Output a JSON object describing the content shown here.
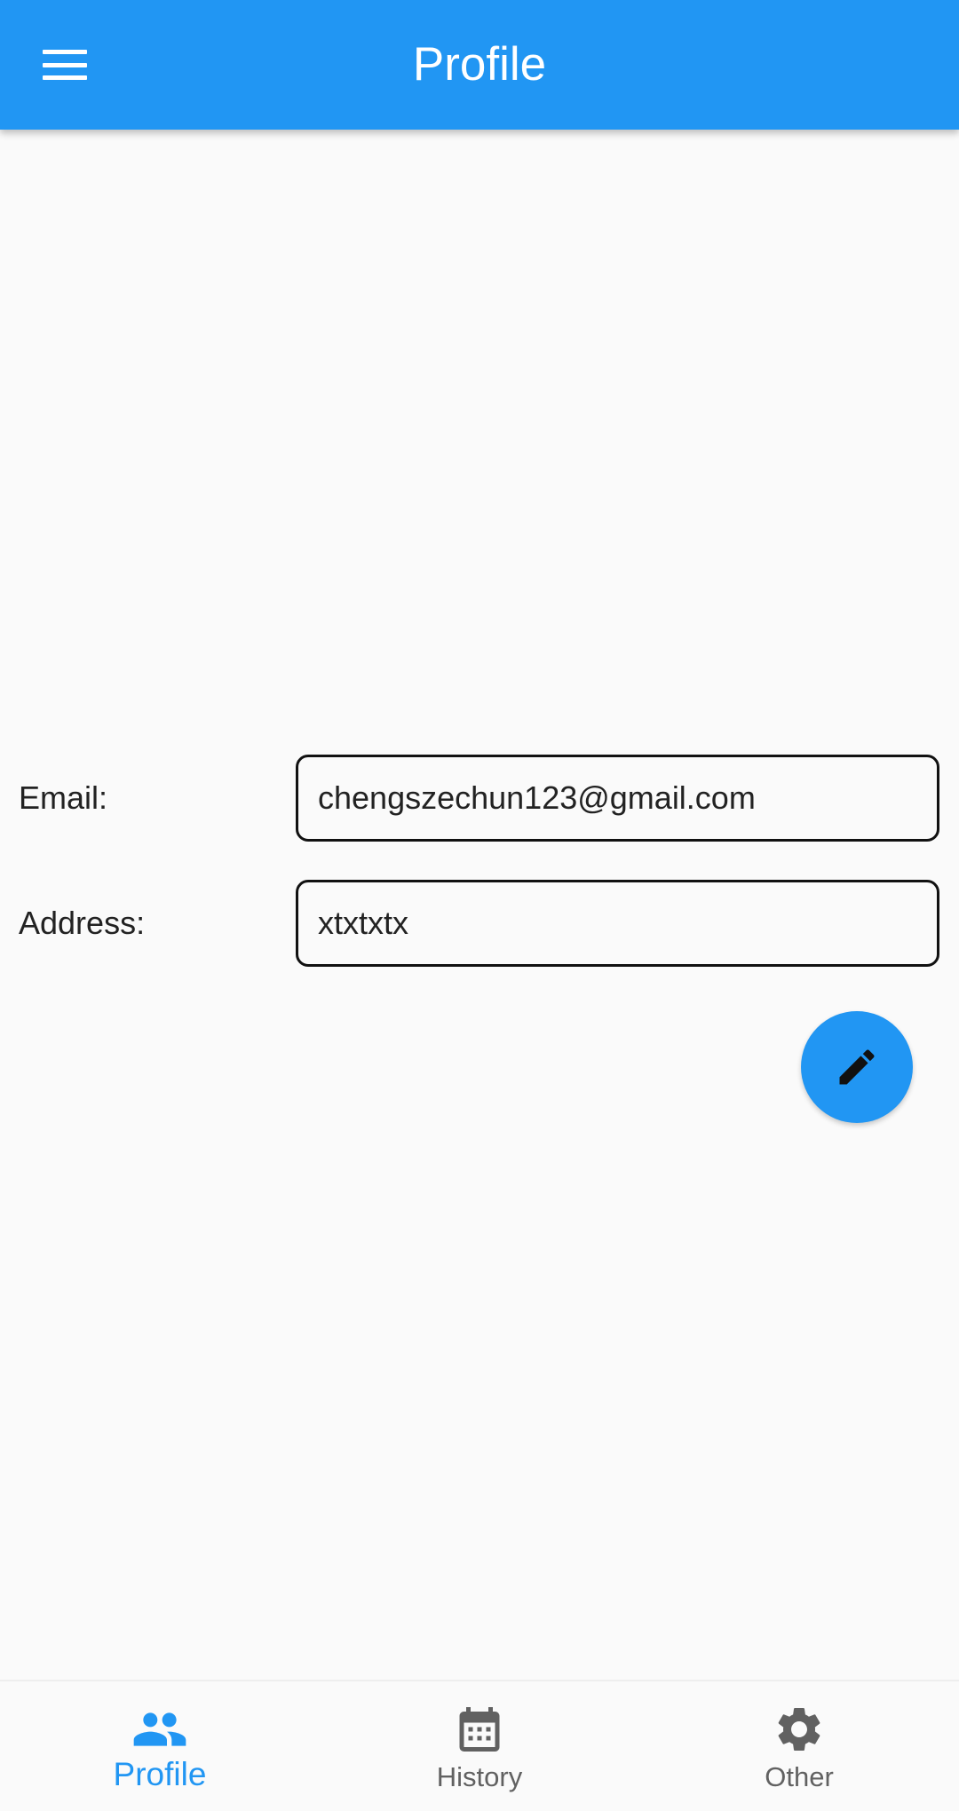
{
  "app_bar": {
    "title": "Profile",
    "menu_icon": "hamburger-menu-icon",
    "background_color": "#2196f3"
  },
  "form": {
    "email": {
      "label": "Email:",
      "value": "chengszechun123@gmail.com"
    },
    "address": {
      "label": "Address:",
      "value": "xtxtxtx"
    }
  },
  "fab": {
    "icon": "edit-pencil-icon",
    "color": "#2196f3"
  },
  "bottom_nav": {
    "items": [
      {
        "label": "Profile",
        "icon": "people-icon",
        "active": true
      },
      {
        "label": "History",
        "icon": "calendar-icon",
        "active": false
      },
      {
        "label": "Other",
        "icon": "gear-icon",
        "active": false
      }
    ],
    "active_color": "#2196f3",
    "inactive_color": "#616161"
  }
}
